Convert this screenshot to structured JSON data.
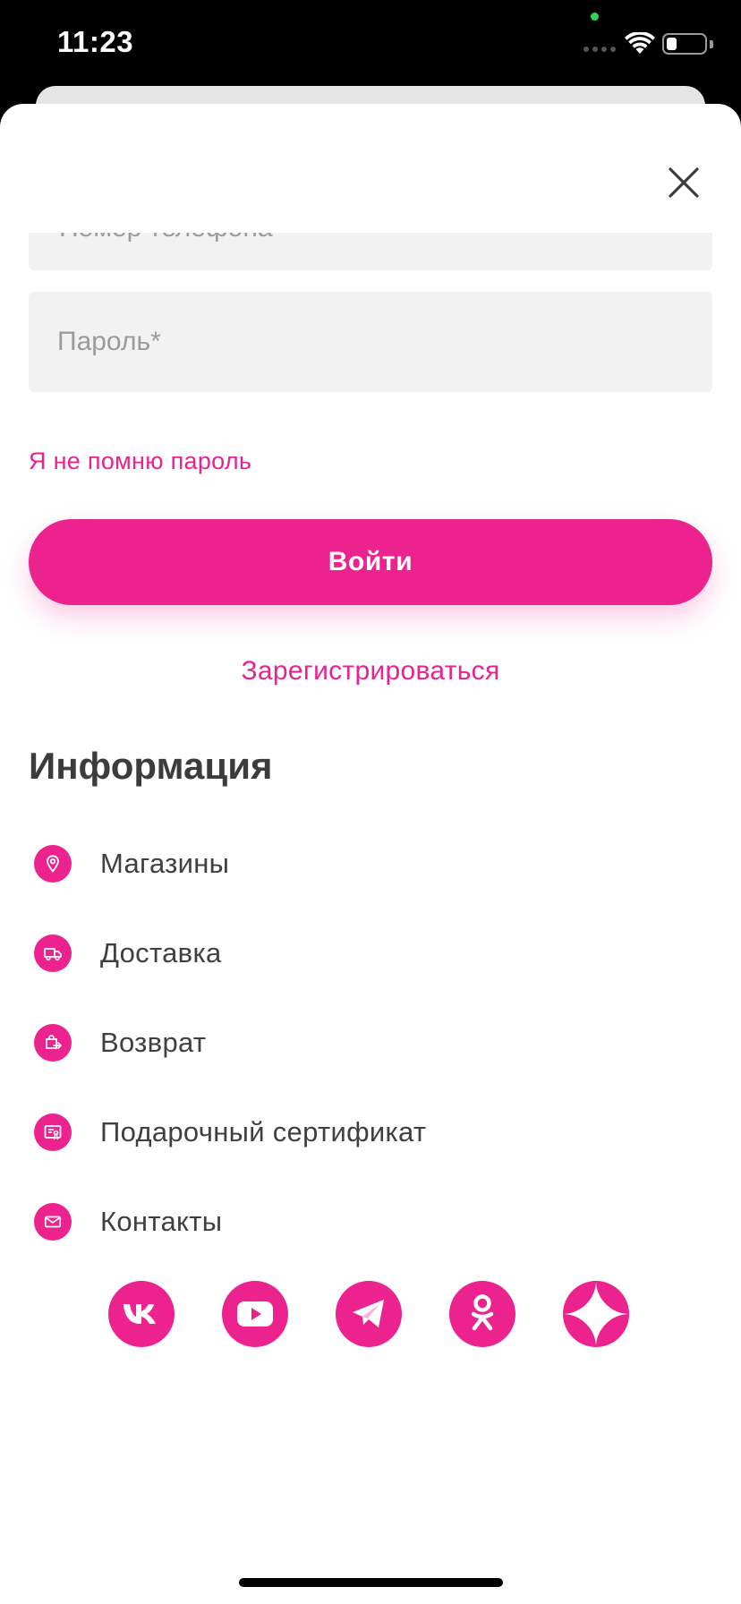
{
  "status_bar": {
    "time": "11:23"
  },
  "login": {
    "phone_placeholder": "Номер телефона*",
    "password_placeholder": "Пароль*",
    "forgot_password": "Я не помню пароль",
    "submit_label": "Войти",
    "register_label": "Зарегистрироваться"
  },
  "info": {
    "title": "Информация",
    "items": [
      {
        "label": "Магазины",
        "icon": "location-pin-icon"
      },
      {
        "label": "Доставка",
        "icon": "truck-icon"
      },
      {
        "label": "Возврат",
        "icon": "return-bag-icon"
      },
      {
        "label": "Подарочный сертификат",
        "icon": "gift-certificate-icon"
      },
      {
        "label": "Контакты",
        "icon": "mail-icon"
      }
    ]
  },
  "socials": [
    {
      "icon": "vk-icon"
    },
    {
      "icon": "youtube-icon"
    },
    {
      "icon": "telegram-icon"
    },
    {
      "icon": "odnoklassniki-icon"
    },
    {
      "icon": "yandex-zen-icon"
    }
  ],
  "colors": {
    "accent": "#ec228e",
    "text": "#3c3c3c",
    "field_bg": "#f2f2f2"
  }
}
